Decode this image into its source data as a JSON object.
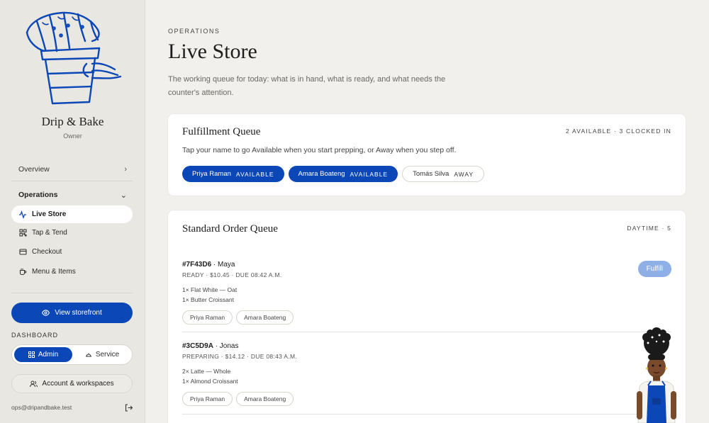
{
  "sidebar": {
    "brand_name": "Drip & Bake",
    "brand_role": "Owner",
    "nav": {
      "overview": "Overview",
      "operations": "Operations",
      "items": [
        {
          "label": "Live Store",
          "icon": "activity-icon",
          "active": true
        },
        {
          "label": "Tap & Tend",
          "icon": "qr-icon",
          "active": false
        },
        {
          "label": "Checkout",
          "icon": "card-icon",
          "active": false
        },
        {
          "label": "Menu & Items",
          "icon": "cup-icon",
          "active": false
        }
      ]
    },
    "storefront_button": "View storefront",
    "dashboard_label": "DASHBOARD",
    "toggle": {
      "admin": "Admin",
      "service": "Service"
    },
    "account_button": "Account & workspaces",
    "email": "ops@dripandbake.test"
  },
  "main": {
    "eyebrow": "OPERATIONS",
    "title": "Live Store",
    "intro": "The working queue for today: what is in hand, what is ready, and what needs the counter's attention."
  },
  "fulfillment": {
    "title": "Fulfillment Queue",
    "meta": "2 AVAILABLE · 3 CLOCKED IN",
    "help": "Tap your name to go Available when you start prepping, or Away when you step off.",
    "staff": [
      {
        "name": "Priya Raman",
        "status": "AVAILABLE"
      },
      {
        "name": "Amara Boateng",
        "status": "AVAILABLE"
      },
      {
        "name": "Tomás Silva",
        "status": "AWAY"
      }
    ]
  },
  "standard_queue": {
    "title": "Standard Order Queue",
    "meta": "DAYTIME · 5",
    "orders": [
      {
        "id": "#7F43D6",
        "customer": "· Maya",
        "status_line": "READY · $10.45  · DUE 08:42 A.M.",
        "items": [
          "1× Flat White — Oat",
          "1× Butter Croissant"
        ],
        "assignees": [
          "Priya Raman",
          "Amara Boateng"
        ],
        "action": "Fulfill"
      },
      {
        "id": "#3C5D9A",
        "customer": "· Jonas",
        "status_line": "PREPARING · $14.12  · DUE 08:43 A.M.",
        "items": [
          "2× Latte — Whole",
          "1× Almond Croissant"
        ],
        "assignees": [
          "Priya Raman",
          "Amara Boateng"
        ]
      }
    ]
  },
  "colors": {
    "accent": "#0c47b7",
    "fulfill_disabled": "#8eb0e6",
    "sidebar_bg": "#e9e7e1",
    "page_bg": "#f1f0ec"
  }
}
